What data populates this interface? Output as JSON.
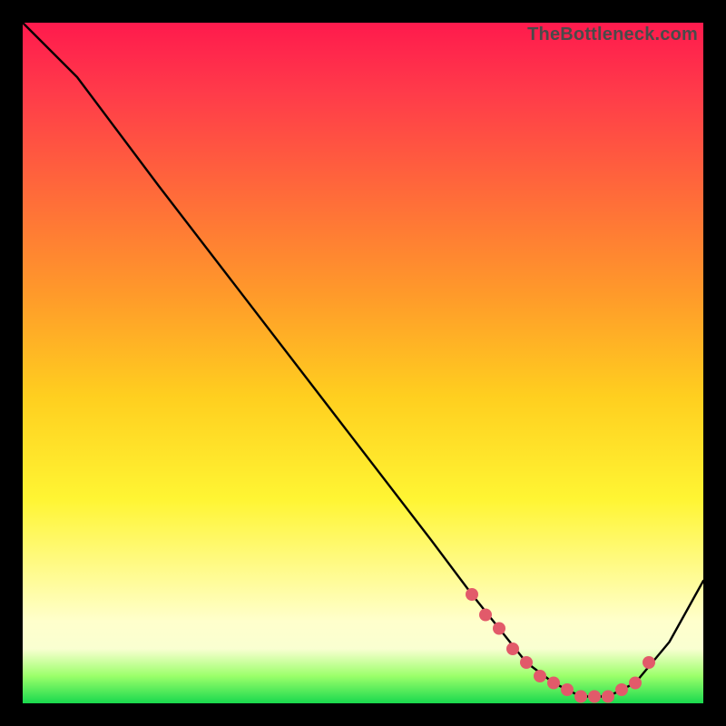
{
  "watermark": "TheBottleneck.com",
  "chart_data": {
    "type": "line",
    "title": "",
    "xlabel": "",
    "ylabel": "",
    "xlim": [
      0,
      100
    ],
    "ylim": [
      0,
      100
    ],
    "grid": false,
    "legend": false,
    "series": [
      {
        "name": "bottleneck-curve",
        "color": "#000000",
        "x": [
          0,
          8,
          20,
          30,
          40,
          50,
          60,
          66,
          70,
          74,
          78,
          82,
          86,
          90,
          95,
          100
        ],
        "y": [
          100,
          92,
          76,
          63,
          50,
          37,
          24,
          16,
          11,
          6,
          3,
          1,
          1,
          3,
          9,
          18
        ]
      }
    ],
    "markers": {
      "name": "highlight-dots",
      "color": "#e25a6a",
      "radius": 7,
      "x": [
        66,
        68,
        70,
        72,
        74,
        76,
        78,
        80,
        82,
        84,
        86,
        88,
        90,
        92
      ],
      "y": [
        16,
        13,
        11,
        8,
        6,
        4,
        3,
        2,
        1,
        1,
        1,
        2,
        3,
        6
      ]
    }
  }
}
